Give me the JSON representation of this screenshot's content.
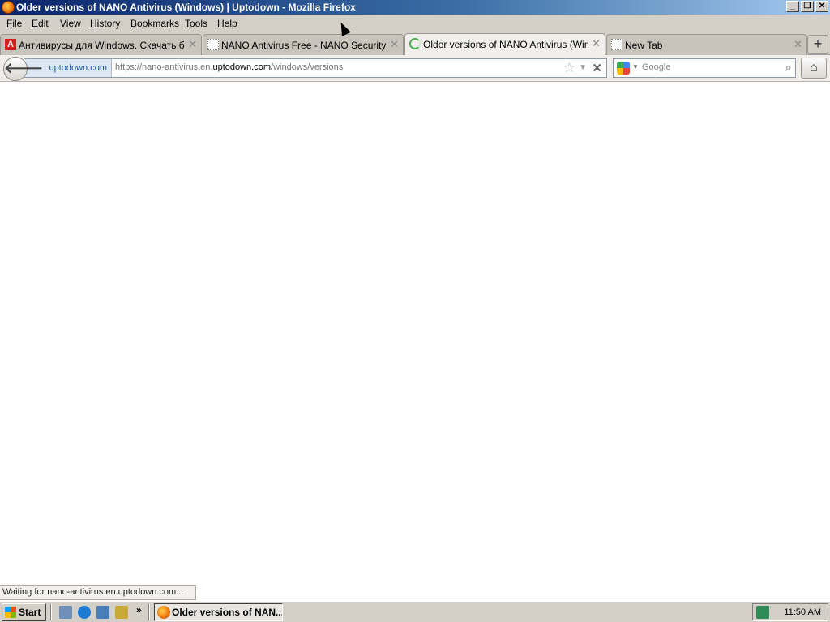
{
  "window": {
    "title": "Older versions of NANO Antivirus (Windows) | Uptodown - Mozilla Firefox",
    "controls": {
      "minimize": "_",
      "maximize": "❐",
      "close": "✕"
    }
  },
  "menu": [
    {
      "label": "File",
      "u": "F",
      "rest": "ile"
    },
    {
      "label": "Edit",
      "u": "E",
      "rest": "dit"
    },
    {
      "label": "View",
      "u": "V",
      "rest": "iew"
    },
    {
      "label": "History",
      "u": "H",
      "rest": "istory"
    },
    {
      "label": "Bookmarks",
      "u": "B",
      "rest": "ookmarks"
    },
    {
      "label": "Tools",
      "u": "T",
      "rest": "ools"
    },
    {
      "label": "Help",
      "u": "H",
      "rest": "elp"
    }
  ],
  "tabs": [
    {
      "label": "Антивирусы для Windows. Скачать бе...",
      "icon": "red-a-favicon-icon",
      "active": false
    },
    {
      "label": "NANO Antivirus Free - NANO Security Ltd.",
      "icon": "blank-page-icon",
      "active": false
    },
    {
      "label": "Older versions of NANO Antivirus (Windo...",
      "icon": "loading-spinner-icon",
      "active": true
    },
    {
      "label": "New Tab",
      "icon": "blank-page-icon",
      "active": false
    }
  ],
  "tab_close": "✕",
  "new_tab": "+",
  "navigation": {
    "back": "🡐",
    "identity": "uptodown.com",
    "url_prefix": "https://nano-antivirus.en.",
    "url_domain": "uptodown.com",
    "url_suffix": "/windows/versions",
    "star": "☆",
    "dropmarker": "▼",
    "stop": "✕",
    "search_placeholder": "Google",
    "search_go": "⌕",
    "home": "⌂"
  },
  "status": "Waiting for nano-antivirus.en.uptodown.com...",
  "taskbar": {
    "start_label": "Start",
    "more": "»",
    "task_label": "Older versions of NAN...",
    "clock": "11:50 AM"
  },
  "colors": {
    "title_gradient_start": "#0a246a",
    "identity_text": "#1a55a8",
    "loading_spinner": "#4caf50"
  }
}
